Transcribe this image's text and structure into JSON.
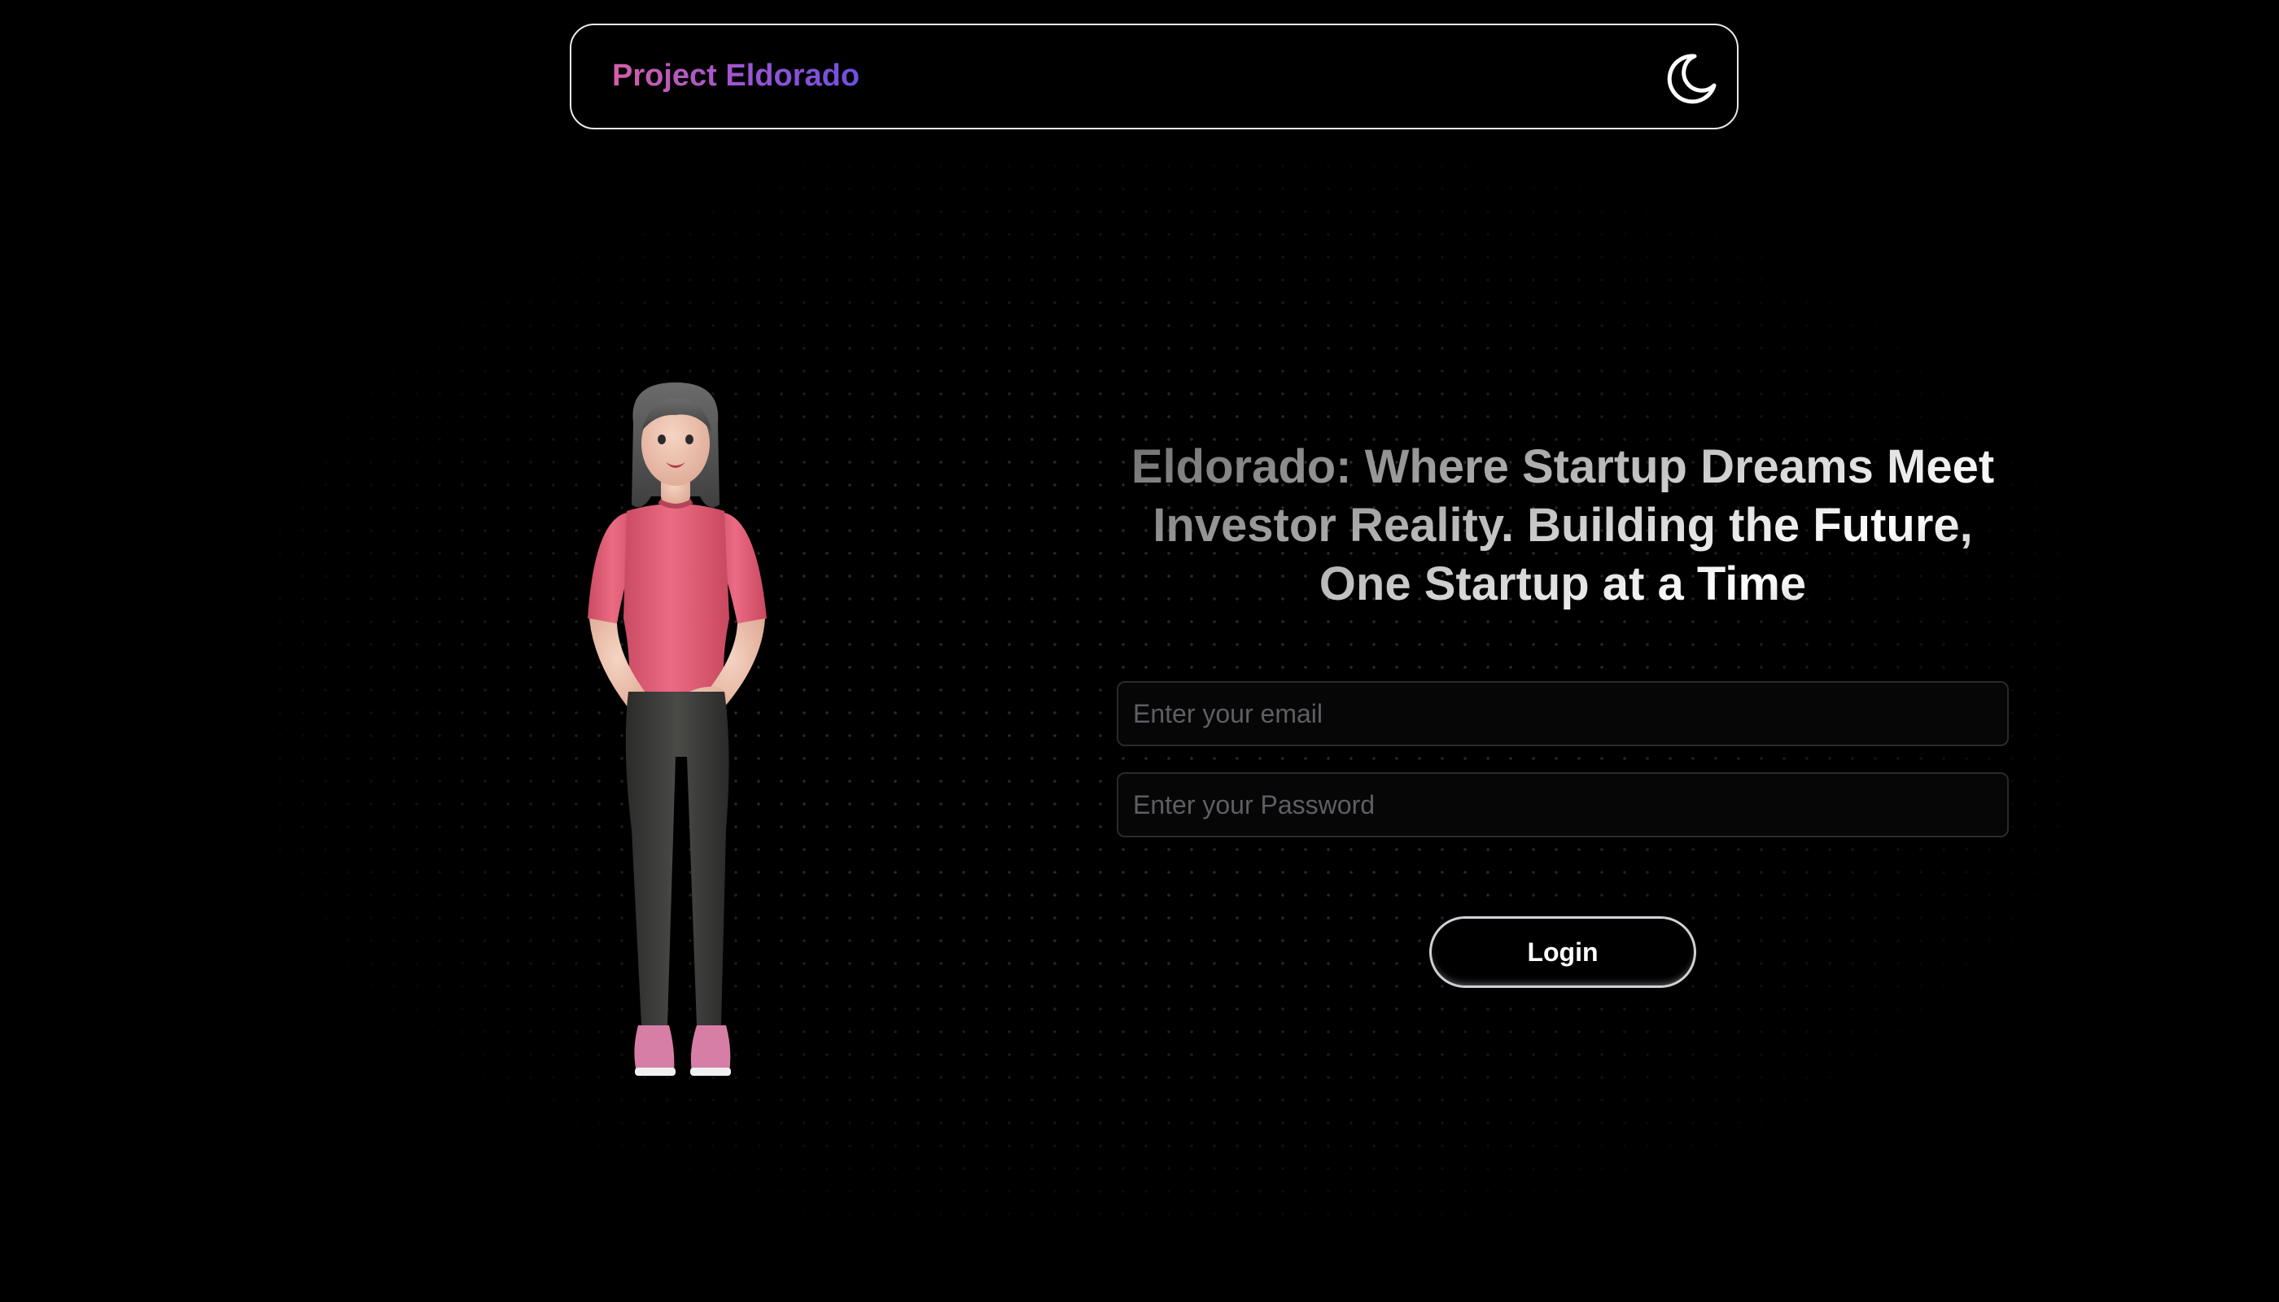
{
  "navbar": {
    "brand": "Project Eldorado",
    "theme_toggle_icon": "moon-icon"
  },
  "illustration": {
    "icon": "person-illustration",
    "colors": {
      "shirt": "#e7607a",
      "pants": "#3a3a38",
      "skin": "#f2c7b4",
      "hair": "#5a5a5a",
      "shoes": "#d77ea6"
    }
  },
  "hero": {
    "headline": "Eldorado: Where Startup Dreams Meet Investor Reality. Building the Future, One Startup at a Time"
  },
  "form": {
    "email_placeholder": "Enter your email",
    "email_value": "",
    "password_placeholder": "Enter your Password",
    "password_value": "",
    "login_label": "Login"
  },
  "theme": {
    "background": "#000000",
    "brand_gradient": [
      "#d45fa6",
      "#6e4fe0"
    ],
    "border": "#e9e9ee"
  }
}
